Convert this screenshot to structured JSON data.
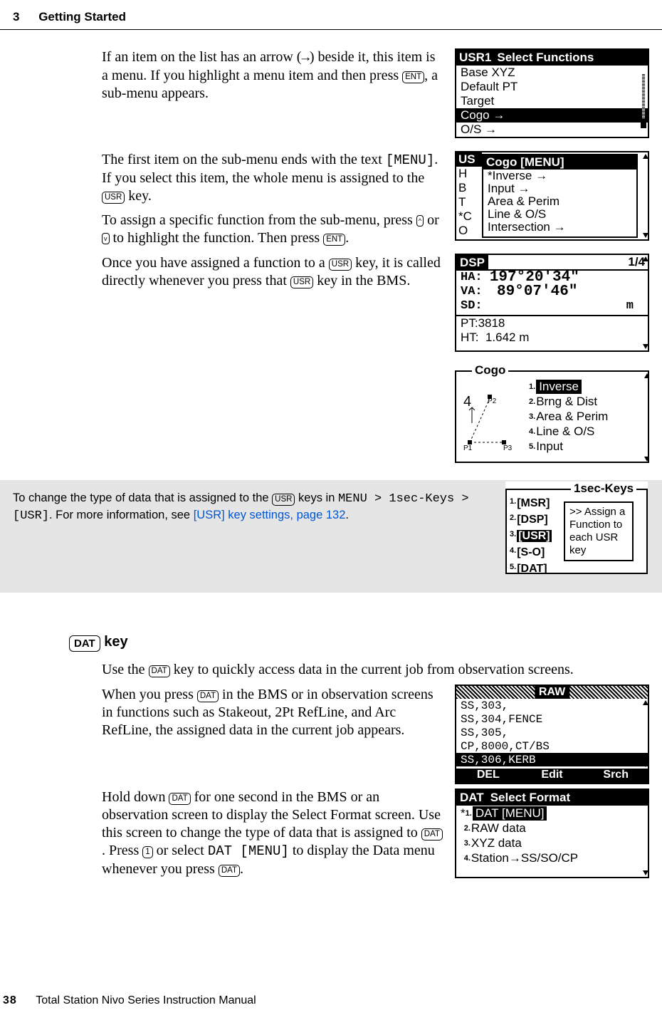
{
  "header": {
    "chapter_number": "3",
    "chapter": "Getting Started"
  },
  "footer": {
    "page_number": "38",
    "manual_title": "Total Station Nivo Series Instruction Manual"
  },
  "para1": {
    "pre": "If an item on the list has an arrow (",
    "arrow_glyph": "→",
    "mid": ") beside it, this item is a menu. If you highlight a menu item and then press ",
    "key": "ENT",
    "post": ", a sub-menu appears."
  },
  "para2": {
    "a": "The first item on the sub-menu ends with the text ",
    "menu_literal": "[MENU]",
    "b": ". If you select this item, the whole menu is assigned to the ",
    "key_usr": "USR",
    "c": " key."
  },
  "para3": {
    "a": "To assign a specific function from the sub-menu, press ",
    "up": "^",
    "or": " or ",
    "dn": "v",
    "b": " to highlight the function. Then press ",
    "ent": "ENT",
    "c": "."
  },
  "para4": {
    "a": "Once you have assigned a function to a ",
    "usr1": "USR",
    "b": " key, it is called directly whenever you press that ",
    "usr2": "USR",
    "c": " key in the BMS."
  },
  "note": {
    "a": "To change the type of data that is assigned to the ",
    "usr": "USR",
    "b": " keys in ",
    "path": "MENU > 1sec-Keys > [USR]",
    "c": ". For more information, see ",
    "link": "[USR] key settings, page 132",
    "d": "."
  },
  "dat_section": {
    "key_label": "DAT",
    "heading_suffix": " key",
    "p1a": "Use the ",
    "dat1": "DAT",
    "p1b": " key to quickly access data in the current job from observation screens.",
    "p2a": "When you press ",
    "dat2": "DAT",
    "p2b": " in the BMS or in observation screens in functions such as Stakeout, 2Pt RefLine, and Arc RefLine, the assigned data in the current job appears.",
    "p3a": "Hold down ",
    "dat3": "DAT",
    "p3b": " for one second in the BMS or an observation screen to display the Select Format screen. Use this screen to change the type of data that is assigned to ",
    "dat4": "DAT",
    "p3c": ". Press ",
    "one_key": "1",
    "p3d": " or select ",
    "dat_menu": "DAT [MENU]",
    "p3e": " to display the Data menu whenever you press ",
    "dat5": "DAT",
    "p3f": "."
  },
  "screen1": {
    "title_left": "USR1",
    "title_right": "Select Functions",
    "rows": [
      "Base XYZ",
      "Default PT",
      "Target",
      "Cogo →",
      "O/S →"
    ],
    "highlight_index": 3
  },
  "screen2": {
    "sidebar": [
      "US",
      "H",
      "B",
      "T",
      "*C",
      "O"
    ],
    "popup_title": "Cogo [MENU]",
    "popup_rows": [
      "*Inverse →",
      "  Input →",
      "  Area & Perim",
      "  Line & O/S",
      "  Intersection →"
    ]
  },
  "screen3": {
    "title_left": "DSP",
    "title_right": "1/4",
    "lines": {
      "ha_label": "HA:",
      "ha_val": "197°20'34\"",
      "va_label": "VA:",
      "va_val": "89°07'46\"",
      "sd_label": "SD:",
      "sd_unit": "m",
      "pt_label": "PT:",
      "pt_val": "3818",
      "ht_label": "HT:",
      "ht_val": "1.642 m"
    }
  },
  "screen4": {
    "legend": "Cogo",
    "rows": [
      "Inverse",
      "Brng & Dist",
      "Area & Perim",
      "Line & O/S",
      "Input"
    ],
    "highlight_index": 0
  },
  "screen5": {
    "legend": "1sec-Keys",
    "left": [
      "[MSR]",
      "[DSP]",
      "[USR]",
      "[S-O]",
      "[DAT]"
    ],
    "highlight_index": 2,
    "bubble": ">> Assign a Function to each USR key"
  },
  "screen6": {
    "title": "RAW",
    "rows": [
      "SS,303,",
      "SS,304,FENCE",
      "SS,305,",
      "CP,8000,CT/BS",
      "SS,306,KERB"
    ],
    "highlight_index": 4,
    "softkeys": [
      "DEL",
      "Edit",
      "Srch"
    ]
  },
  "screen7": {
    "title_left": "DAT",
    "title_right": "Select Format",
    "rows": [
      "DAT [MENU]",
      "RAW data",
      "XYZ data",
      "Station→SS/SO/CP"
    ],
    "highlight_index": 0
  }
}
